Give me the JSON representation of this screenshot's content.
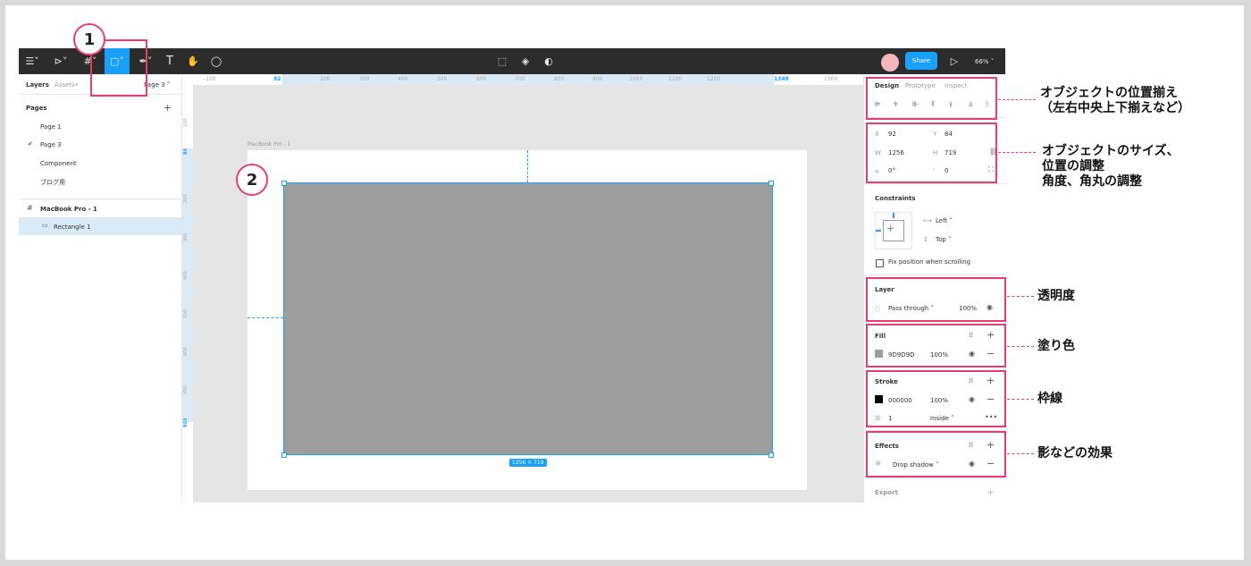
{
  "toolbar": {
    "share_label": "Share",
    "zoom_label": "66%"
  },
  "left_panel": {
    "tabs": [
      "Layers",
      "Assets"
    ],
    "current_page": "Page 3",
    "pages_title": "Pages",
    "pages": [
      "Page 1",
      "Page 3",
      "Component",
      "ブログ用"
    ],
    "selected_page": "Page 3",
    "layers": [
      {
        "name": "MacBook Pro - 1",
        "type": "frame"
      },
      {
        "name": "Rectangle 1",
        "type": "rectangle",
        "selected": true
      }
    ]
  },
  "rulers": {
    "top": [
      "-100",
      "92",
      "200",
      "300",
      "400",
      "500",
      "600",
      "700",
      "800",
      "900",
      "1000",
      "1100",
      "1200",
      "1348",
      "1500"
    ],
    "left": [
      "100",
      "84",
      "200",
      "300",
      "400",
      "500",
      "600",
      "700",
      "803"
    ]
  },
  "canvas": {
    "frame_name": "MacBook Pro - 1",
    "rect_fill": "#9d9d9d",
    "selection_color": "#18a0fb",
    "size_badge": "1256 × 719"
  },
  "right_panel": {
    "tabs": [
      "Design",
      "Prototype",
      "Inspect"
    ],
    "x": "92",
    "y": "84",
    "w": "1256",
    "h": "719",
    "rotation": "0°",
    "radius": "0",
    "constraints_title": "Constraints",
    "constraint_h": "Left",
    "constraint_v": "Top",
    "fix_position": "Fix position when scrolling",
    "layer_title": "Layer",
    "blend": "Pass through",
    "layer_opacity": "100%",
    "fill_title": "Fill",
    "fill_hex": "9D9D9D",
    "fill_opacity": "100%",
    "stroke_title": "Stroke",
    "stroke_hex": "000000",
    "stroke_opacity": "100%",
    "stroke_weight": "1",
    "stroke_position": "Inside",
    "effects_title": "Effects",
    "effect": "Drop shadow",
    "export_title": "Export"
  },
  "annotations": {
    "marker1": "1",
    "marker2": "2",
    "align": [
      "オブジェクトの位置揃え",
      "（左右中央上下揃えなど）"
    ],
    "size": [
      "オブジェクトのサイズ、",
      "位置の調整",
      "角度、角丸の調整"
    ],
    "opacity": "透明度",
    "fill": "塗り色",
    "stroke": "枠線",
    "effects": "影などの効果",
    "highlight_color": "#e83e6b"
  }
}
